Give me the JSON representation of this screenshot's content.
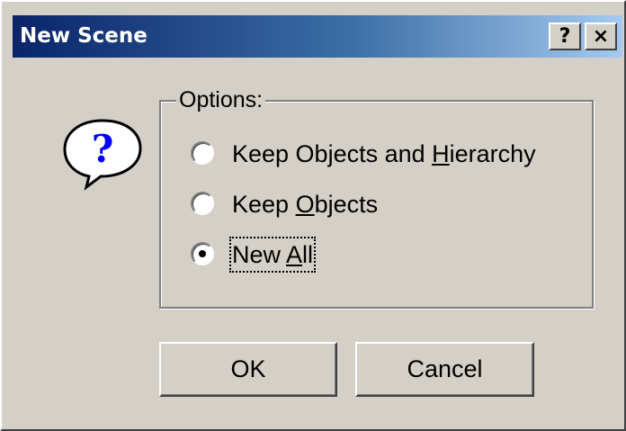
{
  "window": {
    "title": "New Scene",
    "help_button": "?",
    "close_button": "×"
  },
  "options": {
    "group_label": "Options:",
    "items": [
      {
        "pre": "Keep Objects and ",
        "mnemonic": "H",
        "post": "ierarchy",
        "checked": false
      },
      {
        "pre": "Keep ",
        "mnemonic": "O",
        "post": "bjects",
        "checked": false
      },
      {
        "pre": "New ",
        "mnemonic": "A",
        "post": "ll",
        "checked": true
      }
    ]
  },
  "buttons": {
    "ok": "OK",
    "cancel": "Cancel"
  },
  "icons": {
    "dialog_icon": "question-balloon-icon",
    "help": "question-mark-icon",
    "close": "close-icon"
  },
  "colors": {
    "titlebar_start": "#0a246a",
    "titlebar_end": "#a6caf0",
    "face": "#d4d0c8",
    "icon_question": "#0000ff"
  }
}
